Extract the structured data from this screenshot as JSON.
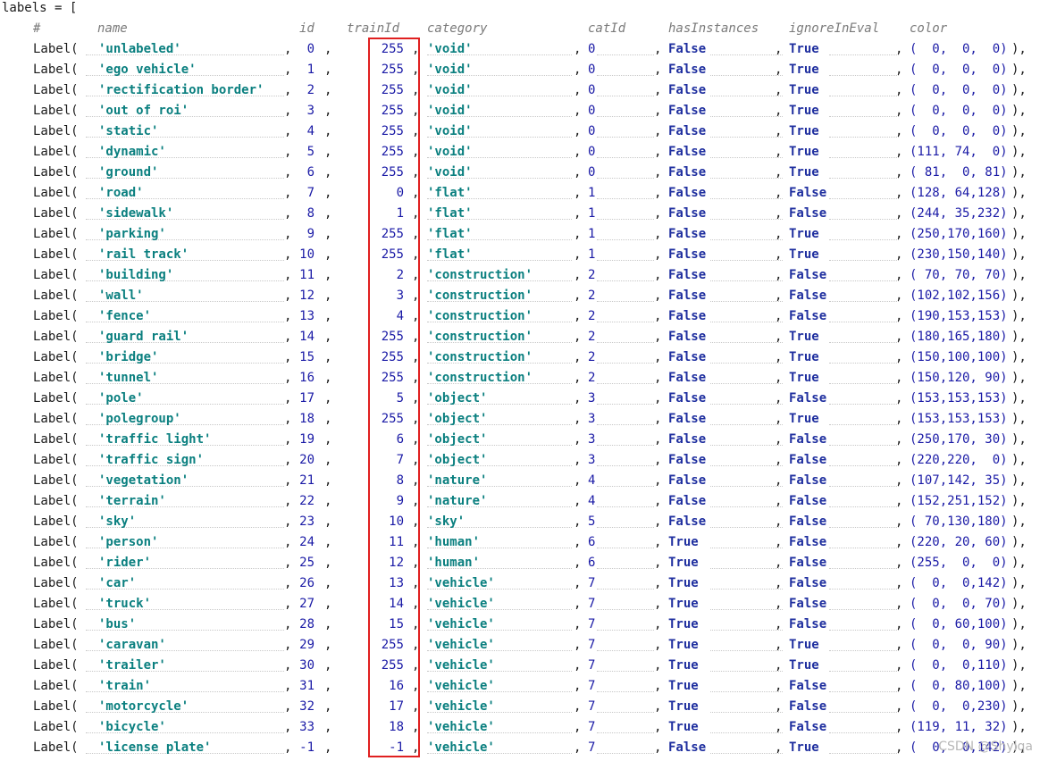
{
  "header": {
    "first_line": "labels = [",
    "hash": "#",
    "cols": [
      "name",
      "id",
      "trainId",
      "category",
      "catId",
      "hasInstances",
      "ignoreInEval",
      "color"
    ]
  },
  "tokens": {
    "label_open": "Label(",
    "sep": ",",
    "close": "),"
  },
  "watermark": "CSDN @Shylqa",
  "rows": [
    {
      "name": "'unlabeled'",
      "id": "0",
      "trainId": "255",
      "category": "'void'",
      "catId": "0",
      "hasInstances": "False",
      "ignoreInEval": "True",
      "color": "(  0,  0,  0)"
    },
    {
      "name": "'ego vehicle'",
      "id": "1",
      "trainId": "255",
      "category": "'void'",
      "catId": "0",
      "hasInstances": "False",
      "ignoreInEval": "True",
      "color": "(  0,  0,  0)"
    },
    {
      "name": "'rectification border'",
      "id": "2",
      "trainId": "255",
      "category": "'void'",
      "catId": "0",
      "hasInstances": "False",
      "ignoreInEval": "True",
      "color": "(  0,  0,  0)"
    },
    {
      "name": "'out of roi'",
      "id": "3",
      "trainId": "255",
      "category": "'void'",
      "catId": "0",
      "hasInstances": "False",
      "ignoreInEval": "True",
      "color": "(  0,  0,  0)"
    },
    {
      "name": "'static'",
      "id": "4",
      "trainId": "255",
      "category": "'void'",
      "catId": "0",
      "hasInstances": "False",
      "ignoreInEval": "True",
      "color": "(  0,  0,  0)"
    },
    {
      "name": "'dynamic'",
      "id": "5",
      "trainId": "255",
      "category": "'void'",
      "catId": "0",
      "hasInstances": "False",
      "ignoreInEval": "True",
      "color": "(111, 74,  0)"
    },
    {
      "name": "'ground'",
      "id": "6",
      "trainId": "255",
      "category": "'void'",
      "catId": "0",
      "hasInstances": "False",
      "ignoreInEval": "True",
      "color": "( 81,  0, 81)"
    },
    {
      "name": "'road'",
      "id": "7",
      "trainId": "0",
      "category": "'flat'",
      "catId": "1",
      "hasInstances": "False",
      "ignoreInEval": "False",
      "color": "(128, 64,128)"
    },
    {
      "name": "'sidewalk'",
      "id": "8",
      "trainId": "1",
      "category": "'flat'",
      "catId": "1",
      "hasInstances": "False",
      "ignoreInEval": "False",
      "color": "(244, 35,232)"
    },
    {
      "name": "'parking'",
      "id": "9",
      "trainId": "255",
      "category": "'flat'",
      "catId": "1",
      "hasInstances": "False",
      "ignoreInEval": "True",
      "color": "(250,170,160)"
    },
    {
      "name": "'rail track'",
      "id": "10",
      "trainId": "255",
      "category": "'flat'",
      "catId": "1",
      "hasInstances": "False",
      "ignoreInEval": "True",
      "color": "(230,150,140)"
    },
    {
      "name": "'building'",
      "id": "11",
      "trainId": "2",
      "category": "'construction'",
      "catId": "2",
      "hasInstances": "False",
      "ignoreInEval": "False",
      "color": "( 70, 70, 70)"
    },
    {
      "name": "'wall'",
      "id": "12",
      "trainId": "3",
      "category": "'construction'",
      "catId": "2",
      "hasInstances": "False",
      "ignoreInEval": "False",
      "color": "(102,102,156)"
    },
    {
      "name": "'fence'",
      "id": "13",
      "trainId": "4",
      "category": "'construction'",
      "catId": "2",
      "hasInstances": "False",
      "ignoreInEval": "False",
      "color": "(190,153,153)"
    },
    {
      "name": "'guard rail'",
      "id": "14",
      "trainId": "255",
      "category": "'construction'",
      "catId": "2",
      "hasInstances": "False",
      "ignoreInEval": "True",
      "color": "(180,165,180)"
    },
    {
      "name": "'bridge'",
      "id": "15",
      "trainId": "255",
      "category": "'construction'",
      "catId": "2",
      "hasInstances": "False",
      "ignoreInEval": "True",
      "color": "(150,100,100)"
    },
    {
      "name": "'tunnel'",
      "id": "16",
      "trainId": "255",
      "category": "'construction'",
      "catId": "2",
      "hasInstances": "False",
      "ignoreInEval": "True",
      "color": "(150,120, 90)"
    },
    {
      "name": "'pole'",
      "id": "17",
      "trainId": "5",
      "category": "'object'",
      "catId": "3",
      "hasInstances": "False",
      "ignoreInEval": "False",
      "color": "(153,153,153)"
    },
    {
      "name": "'polegroup'",
      "id": "18",
      "trainId": "255",
      "category": "'object'",
      "catId": "3",
      "hasInstances": "False",
      "ignoreInEval": "True",
      "color": "(153,153,153)"
    },
    {
      "name": "'traffic light'",
      "id": "19",
      "trainId": "6",
      "category": "'object'",
      "catId": "3",
      "hasInstances": "False",
      "ignoreInEval": "False",
      "color": "(250,170, 30)"
    },
    {
      "name": "'traffic sign'",
      "id": "20",
      "trainId": "7",
      "category": "'object'",
      "catId": "3",
      "hasInstances": "False",
      "ignoreInEval": "False",
      "color": "(220,220,  0)"
    },
    {
      "name": "'vegetation'",
      "id": "21",
      "trainId": "8",
      "category": "'nature'",
      "catId": "4",
      "hasInstances": "False",
      "ignoreInEval": "False",
      "color": "(107,142, 35)"
    },
    {
      "name": "'terrain'",
      "id": "22",
      "trainId": "9",
      "category": "'nature'",
      "catId": "4",
      "hasInstances": "False",
      "ignoreInEval": "False",
      "color": "(152,251,152)"
    },
    {
      "name": "'sky'",
      "id": "23",
      "trainId": "10",
      "category": "'sky'",
      "catId": "5",
      "hasInstances": "False",
      "ignoreInEval": "False",
      "color": "( 70,130,180)"
    },
    {
      "name": "'person'",
      "id": "24",
      "trainId": "11",
      "category": "'human'",
      "catId": "6",
      "hasInstances": "True",
      "ignoreInEval": "False",
      "color": "(220, 20, 60)"
    },
    {
      "name": "'rider'",
      "id": "25",
      "trainId": "12",
      "category": "'human'",
      "catId": "6",
      "hasInstances": "True",
      "ignoreInEval": "False",
      "color": "(255,  0,  0)"
    },
    {
      "name": "'car'",
      "id": "26",
      "trainId": "13",
      "category": "'vehicle'",
      "catId": "7",
      "hasInstances": "True",
      "ignoreInEval": "False",
      "color": "(  0,  0,142)"
    },
    {
      "name": "'truck'",
      "id": "27",
      "trainId": "14",
      "category": "'vehicle'",
      "catId": "7",
      "hasInstances": "True",
      "ignoreInEval": "False",
      "color": "(  0,  0, 70)"
    },
    {
      "name": "'bus'",
      "id": "28",
      "trainId": "15",
      "category": "'vehicle'",
      "catId": "7",
      "hasInstances": "True",
      "ignoreInEval": "False",
      "color": "(  0, 60,100)"
    },
    {
      "name": "'caravan'",
      "id": "29",
      "trainId": "255",
      "category": "'vehicle'",
      "catId": "7",
      "hasInstances": "True",
      "ignoreInEval": "True",
      "color": "(  0,  0, 90)"
    },
    {
      "name": "'trailer'",
      "id": "30",
      "trainId": "255",
      "category": "'vehicle'",
      "catId": "7",
      "hasInstances": "True",
      "ignoreInEval": "True",
      "color": "(  0,  0,110)"
    },
    {
      "name": "'train'",
      "id": "31",
      "trainId": "16",
      "category": "'vehicle'",
      "catId": "7",
      "hasInstances": "True",
      "ignoreInEval": "False",
      "color": "(  0, 80,100)"
    },
    {
      "name": "'motorcycle'",
      "id": "32",
      "trainId": "17",
      "category": "'vehicle'",
      "catId": "7",
      "hasInstances": "True",
      "ignoreInEval": "False",
      "color": "(  0,  0,230)"
    },
    {
      "name": "'bicycle'",
      "id": "33",
      "trainId": "18",
      "category": "'vehicle'",
      "catId": "7",
      "hasInstances": "True",
      "ignoreInEval": "False",
      "color": "(119, 11, 32)"
    },
    {
      "name": "'license plate'",
      "id": "-1",
      "trainId": "-1",
      "category": "'vehicle'",
      "catId": "7",
      "hasInstances": "False",
      "ignoreInEval": "True",
      "color": "(  0,  0,142)"
    }
  ]
}
